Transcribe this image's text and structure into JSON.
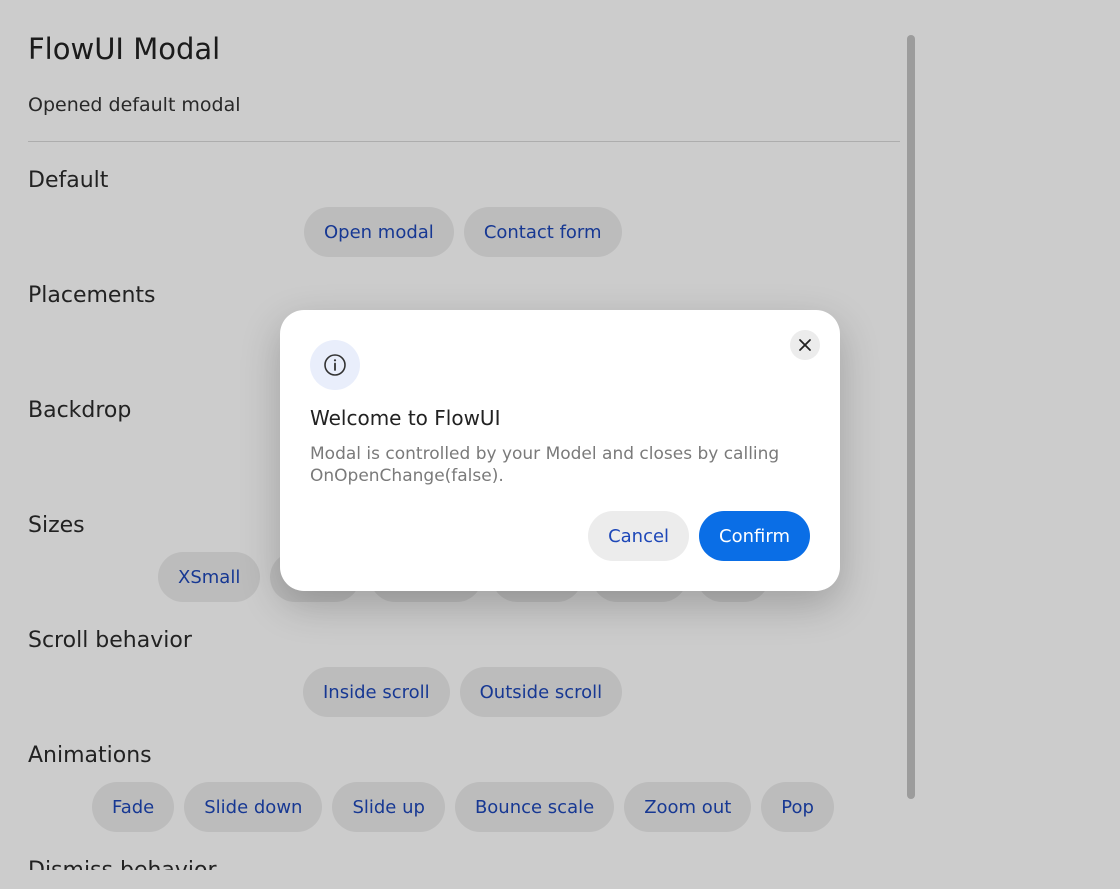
{
  "page": {
    "title": "FlowUI Modal",
    "status": "Opened default modal"
  },
  "sections": {
    "default": {
      "title": "Default",
      "buttons": [
        "Open modal",
        "Contact form"
      ]
    },
    "placements": {
      "title": "Placements"
    },
    "backdrop": {
      "title": "Backdrop"
    },
    "sizes": {
      "title": "Sizes",
      "buttons": [
        "XSmall"
      ]
    },
    "scroll": {
      "title": "Scroll behavior",
      "buttons": [
        "Inside scroll",
        "Outside scroll"
      ]
    },
    "animations": {
      "title": "Animations",
      "buttons": [
        "Fade",
        "Slide down",
        "Slide up",
        "Bounce scale",
        "Zoom out",
        "Pop"
      ]
    },
    "dismiss": {
      "title": "Dismiss behavior"
    }
  },
  "modal": {
    "icon": "info-icon",
    "title": "Welcome to FlowUI",
    "body": "Modal is controlled by your Model and closes by calling OnOpenChange(false).",
    "cancel_label": "Cancel",
    "confirm_label": "Confirm",
    "close_icon": "close-icon"
  },
  "colors": {
    "accent": "#0a6ee6",
    "link_text": "#1d47b8",
    "pill_bg": "#ececec",
    "backdrop": "rgba(0,0,0,0.20)"
  }
}
